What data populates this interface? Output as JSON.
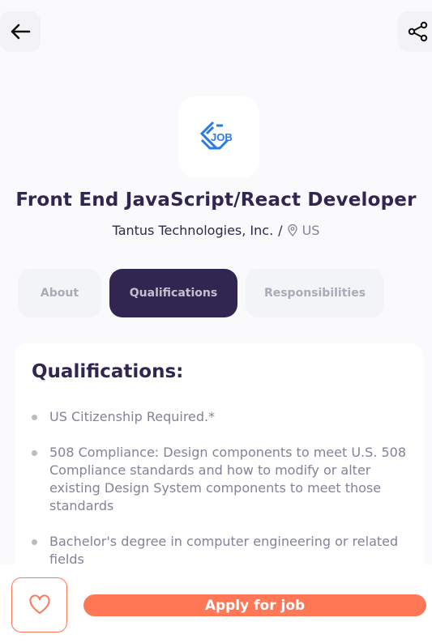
{
  "header": {
    "back_icon": "arrow-left-icon",
    "share_icon": "share-icon"
  },
  "job": {
    "logo_text": "JOB",
    "title": "Front End JavaScript/React Developer",
    "company": "Tantus Technologies, Inc.",
    "separator": "/",
    "location_icon": "location-pin-icon",
    "location": "US"
  },
  "tabs": [
    {
      "label": "About",
      "active": false
    },
    {
      "label": "Qualifications",
      "active": true
    },
    {
      "label": "Responsibilities",
      "active": false
    }
  ],
  "section": {
    "title": "Qualifications:",
    "items": [
      "US Citizenship Required.*",
      "508 Compliance: Design components to meet U.S. 508 Compliance standards and how to modify or alter existing Design System components to meet those standards",
      "Bachelor's degree in computer engineering or related fields"
    ]
  },
  "footer": {
    "like_icon": "heart-icon",
    "apply_label": "Apply for job"
  },
  "colors": {
    "primary": "#312651",
    "accent": "#FF7754",
    "muted": "#83829A"
  }
}
